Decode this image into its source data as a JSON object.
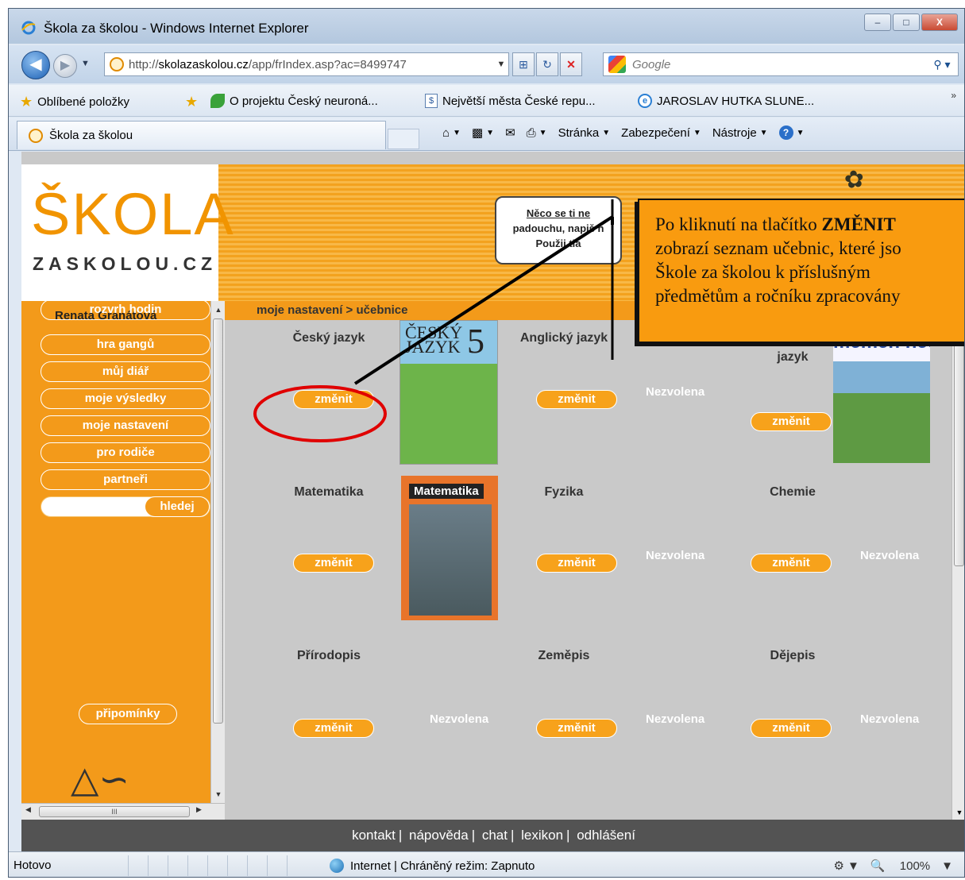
{
  "window": {
    "title": "Škola za školou - Windows Internet Explorer",
    "controls": {
      "minimize": "–",
      "maximize": "□",
      "close": "X"
    }
  },
  "nav": {
    "url_prefix": "http://",
    "url_domain": "skolazaskolou.cz",
    "url_path": "/app/frIndex.asp?ac=8499747",
    "search_placeholder": "Google"
  },
  "favorites": {
    "label": "Oblíbené položky",
    "items": [
      "O projektu Český neuroná...",
      "Největší města České repu...",
      "JAROSLAV HUTKA SLUNE..."
    ]
  },
  "tab": {
    "title": "Škola za školou"
  },
  "commands": {
    "page": "Stránka",
    "security": "Zabezpečení",
    "tools": "Nástroje"
  },
  "logo": {
    "main": "ŠKOLA",
    "sub": "ZASKOLOU.CZ"
  },
  "bubble": {
    "line1": "Něco se ti ne",
    "line2": "padouchu, napiš n",
    "line3": "Použij tla"
  },
  "sidebar": {
    "user": "Renata Granátová",
    "items": [
      "rozvrh hodin",
      "hra gangů",
      "můj diář",
      "moje výsledky",
      "moje nastavení",
      "pro rodiče",
      "partneři"
    ],
    "search_button": "hledej",
    "feedback": "připomínky"
  },
  "breadcrumb": "moje nastavení > učebnice",
  "subjects": {
    "cesky": "Český jazyk",
    "anglicky": "Anglický jazyk",
    "nemecky": "jazyk",
    "matematika": "Matematika",
    "fyzika": "Fyzika",
    "chemie": "Chemie",
    "prirodopis": "Přírodopis",
    "zemepis": "Zeměpis",
    "dejepis": "Dějepis"
  },
  "change_label": "změnit",
  "not_selected": "Nezvolena",
  "books": {
    "cesky_title": "ČESKÝ JAZYK",
    "cesky_num": "5",
    "mat_title": "Matematika",
    "nem_title": "memen neu"
  },
  "annotation": {
    "line1_pre": "Po kliknutí na tlačítko ",
    "line1_bold": "ZMĚNIT",
    "line2": "zobrazí seznam učebnic, které jso",
    "line3": "Škole za školou k příslušným",
    "line4": "předmětům a ročníku zpracovány"
  },
  "footer": {
    "items": [
      "kontakt",
      "nápověda",
      "chat",
      "lexikon",
      "odhlášení"
    ]
  },
  "status": {
    "left": "Hotovo",
    "zone": "Internet | Chráněný režim: Zapnuto",
    "zoom": "100%"
  }
}
